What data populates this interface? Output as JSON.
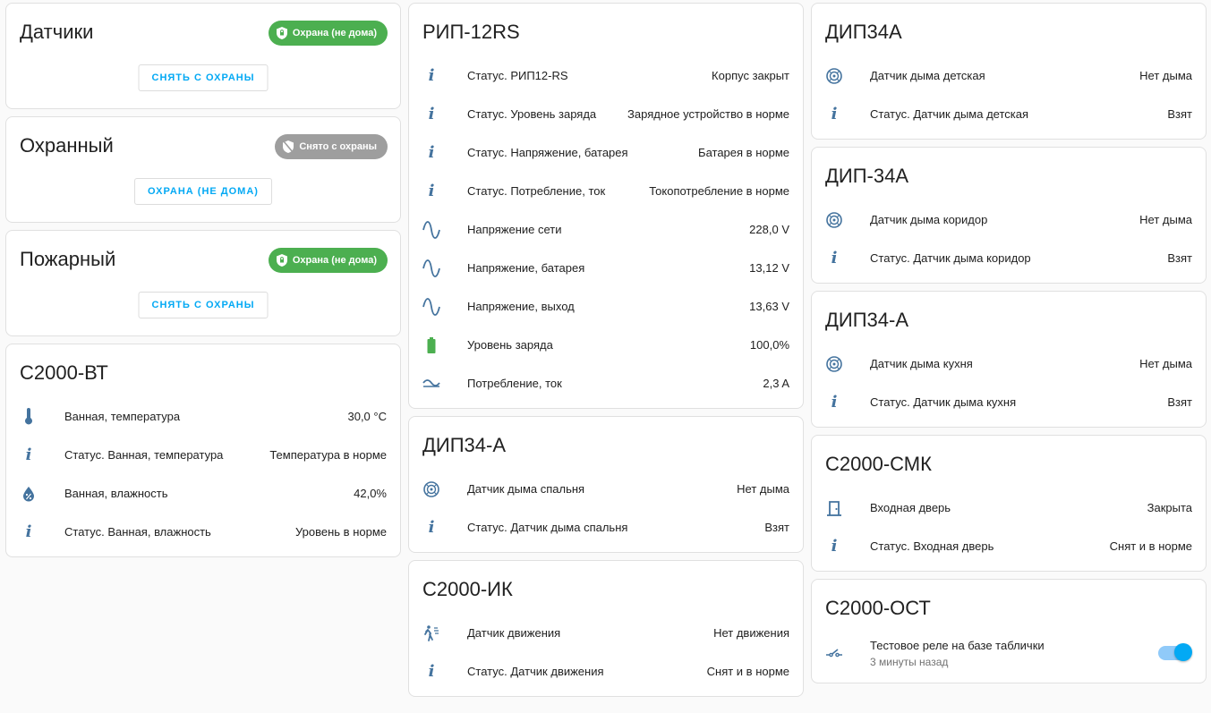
{
  "colors": {
    "accent": "#03a9f4",
    "armed_badge": "#4caf50",
    "disarmed_badge": "#9e9e9e",
    "icon": "#44739e",
    "battery": "#4caf50"
  },
  "alarms": [
    {
      "title": "Датчики",
      "badge": "Охрана (не дома)",
      "badge_state": "armed",
      "button": "СНЯТЬ С ОХРАНЫ"
    },
    {
      "title": "Охранный",
      "badge": "Снято с охраны",
      "badge_state": "disarmed",
      "button": "ОХРАНА (НЕ ДОМА)"
    },
    {
      "title": "Пожарный",
      "badge": "Охрана (не дома)",
      "badge_state": "armed",
      "button": "СНЯТЬ С ОХРАНЫ"
    }
  ],
  "c2000vt": {
    "title": "С2000-ВТ",
    "rows": [
      {
        "icon": "thermometer-icon",
        "name": "Ванная, температура",
        "value": "30,0 °C"
      },
      {
        "icon": "info-icon",
        "name": "Статус. Ванная, температура",
        "value": "Температура в норме"
      },
      {
        "icon": "water-percent-icon",
        "name": "Ванная, влажность",
        "value": "42,0%"
      },
      {
        "icon": "info-icon",
        "name": "Статус. Ванная, влажность",
        "value": "Уровень в норме"
      }
    ]
  },
  "rip": {
    "title": "РИП-12RS",
    "rows": [
      {
        "icon": "info-icon",
        "name": "Статус. РИП12-RS",
        "value": "Корпус закрыт"
      },
      {
        "icon": "info-icon",
        "name": "Статус. Уровень заряда",
        "value": "Зарядное устройство в норме"
      },
      {
        "icon": "info-icon",
        "name": "Статус. Напряжение, батарея",
        "value": "Батарея в норме"
      },
      {
        "icon": "info-icon",
        "name": "Статус. Потребление, ток",
        "value": "Токопотребление в норме"
      },
      {
        "icon": "sine-wave-icon",
        "name": "Напряжение сети",
        "value": "228,0 V"
      },
      {
        "icon": "sine-wave-icon",
        "name": "Напряжение, батарея",
        "value": "13,12 V"
      },
      {
        "icon": "sine-wave-icon",
        "name": "Напряжение, выход",
        "value": "13,63 V"
      },
      {
        "icon": "battery-icon",
        "name": "Уровень заряда",
        "value": "100,0%"
      },
      {
        "icon": "current-ac-icon",
        "name": "Потребление, ток",
        "value": "2,3 A"
      }
    ]
  },
  "dip_bedroom": {
    "title": "ДИП34-А",
    "rows": [
      {
        "icon": "smoke-detector-icon",
        "name": "Датчик дыма спальня",
        "value": "Нет дыма"
      },
      {
        "icon": "info-icon",
        "name": "Статус. Датчик дыма спальня",
        "value": "Взят"
      }
    ]
  },
  "c2000ik": {
    "title": "С2000-ИК",
    "rows": [
      {
        "icon": "motion-sensor-icon",
        "name": "Датчик движения",
        "value": "Нет движения"
      },
      {
        "icon": "info-icon",
        "name": "Статус. Датчик движения",
        "value": "Снят и в норме"
      }
    ]
  },
  "dip_kids": {
    "title": "ДИП34А",
    "rows": [
      {
        "icon": "smoke-detector-icon",
        "name": "Датчик дыма детская",
        "value": "Нет дыма"
      },
      {
        "icon": "info-icon",
        "name": "Статус. Датчик дыма детская",
        "value": "Взят"
      }
    ]
  },
  "dip_corridor": {
    "title": "ДИП-34А",
    "rows": [
      {
        "icon": "smoke-detector-icon",
        "name": "Датчик дыма коридор",
        "value": "Нет дыма"
      },
      {
        "icon": "info-icon",
        "name": "Статус. Датчик дыма коридор",
        "value": "Взят"
      }
    ]
  },
  "dip_kitchen": {
    "title": "ДИП34-А",
    "rows": [
      {
        "icon": "smoke-detector-icon",
        "name": "Датчик дыма кухня",
        "value": "Нет дыма"
      },
      {
        "icon": "info-icon",
        "name": "Статус. Датчик дыма кухня",
        "value": "Взят"
      }
    ]
  },
  "c2000smk": {
    "title": "С2000-СМК",
    "rows": [
      {
        "icon": "door-icon",
        "name": "Входная дверь",
        "value": "Закрыта"
      },
      {
        "icon": "info-icon",
        "name": "Статус. Входная дверь",
        "value": "Снят и в норме"
      }
    ]
  },
  "c2000ost": {
    "title": "С2000-ОСТ",
    "relay": {
      "icon": "relay-switch-icon",
      "name": "Тестовое реле на базе таблички",
      "secondary": "3 минуты назад",
      "state": "on"
    }
  }
}
